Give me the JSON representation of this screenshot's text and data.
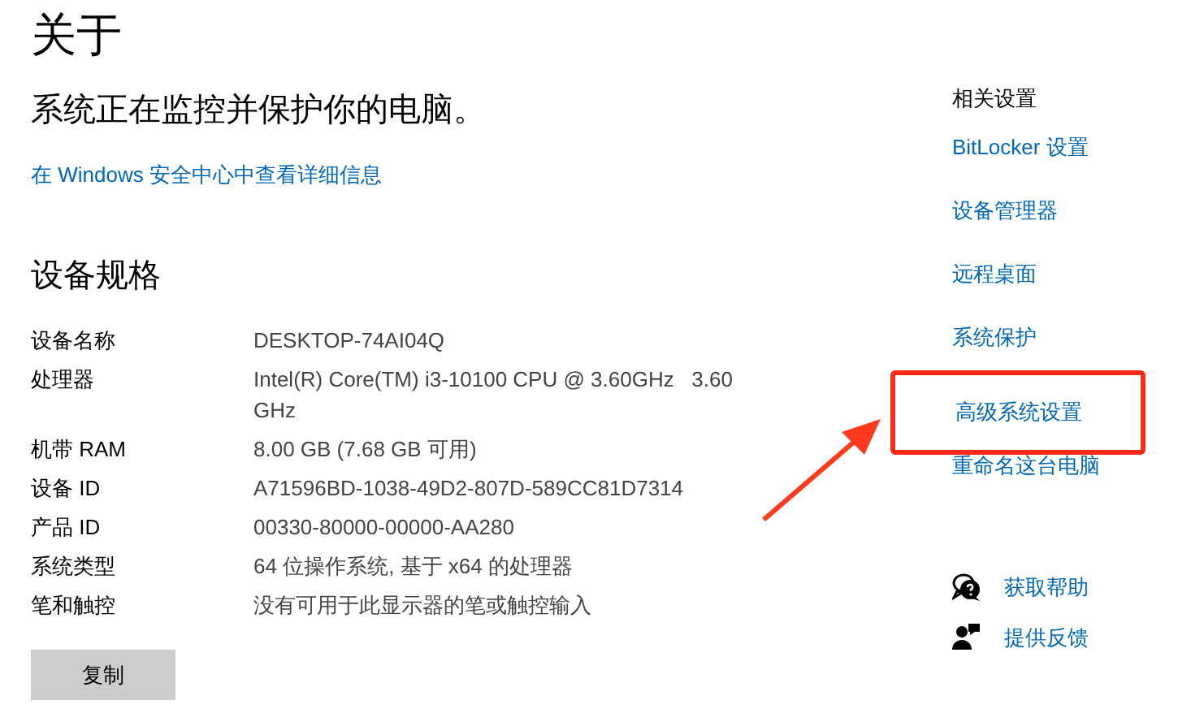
{
  "page_title": "关于",
  "status": "系统正在监控并保护你的电脑。",
  "security_link": "在 Windows 安全中心中查看详细信息",
  "specs_heading": "设备规格",
  "specs": [
    {
      "label": "设备名称",
      "value": "DESKTOP-74AI04Q"
    },
    {
      "label": "处理器",
      "value": "Intel(R) Core(TM) i3-10100 CPU @ 3.60GHz   3.60 GHz"
    },
    {
      "label": "机带 RAM",
      "value": "8.00 GB (7.68 GB 可用)"
    },
    {
      "label": "设备 ID",
      "value": "A71596BD-1038-49D2-807D-589CC81D7314"
    },
    {
      "label": "产品 ID",
      "value": "00330-80000-00000-AA280"
    },
    {
      "label": "系统类型",
      "value": "64 位操作系统, 基于 x64 的处理器"
    },
    {
      "label": "笔和触控",
      "value": "没有可用于此显示器的笔或触控输入"
    }
  ],
  "copy_button": "复制",
  "related_heading": "相关设置",
  "related_links": [
    {
      "label": "BitLocker 设置",
      "highlighted": false
    },
    {
      "label": "设备管理器",
      "highlighted": false
    },
    {
      "label": "远程桌面",
      "highlighted": false
    },
    {
      "label": "系统保护",
      "highlighted": false
    },
    {
      "label": "高级系统设置",
      "highlighted": true
    },
    {
      "label": "重命名这台电脑",
      "highlighted": false
    }
  ],
  "help_links": [
    {
      "kind": "help",
      "label": "获取帮助"
    },
    {
      "kind": "feedback",
      "label": "提供反馈"
    }
  ]
}
